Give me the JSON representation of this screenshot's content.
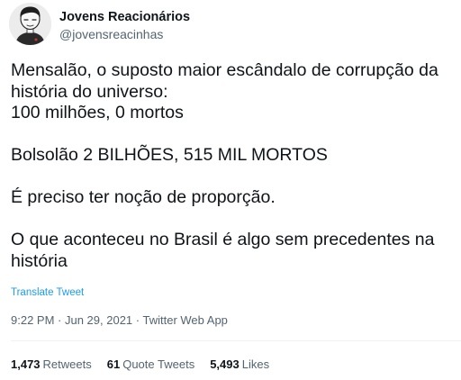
{
  "author": {
    "display_name": "Jovens Reacionários",
    "handle": "@jovensreacinhas",
    "avatar_icon": "cartoon-face-avatar"
  },
  "tweet": {
    "lines": [
      "Mensalão, o suposto maior escândalo de corrupção da",
      "história do universo:",
      "100 milhões, 0 mortos",
      "",
      "Bolsolão 2 BILHÕES, 515 MIL MORTOS",
      "",
      "É preciso ter noção de proporção.",
      "",
      "O que aconteceu no Brasil é algo sem precedentes na",
      "história"
    ],
    "translate_label": "Translate Tweet"
  },
  "meta": {
    "time": "9:22 PM",
    "separator_1": " · ",
    "date": "Jun 29, 2021",
    "separator_2": " · ",
    "source": "Twitter Web App"
  },
  "stats": {
    "retweets_count": "1,473",
    "retweets_label": "Retweets",
    "quotes_count": "61",
    "quotes_label": "Quote Tweets",
    "likes_count": "5,493",
    "likes_label": "Likes"
  },
  "colors": {
    "text_primary": "#0f1419",
    "text_secondary": "#536471",
    "link": "#1d9bf0",
    "divider": "#eff3f4"
  }
}
